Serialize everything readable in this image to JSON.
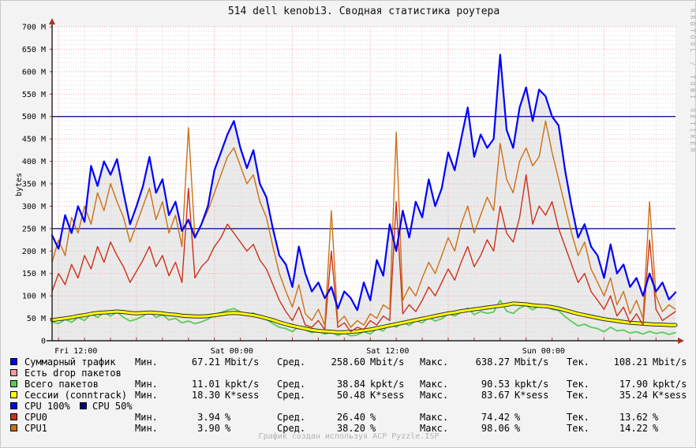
{
  "title": "514 dell kenobi3. Сводная статистика роутера",
  "watermark": "RRDTOOL / TOBI OETIKER",
  "footer": "График создан используя ACP Pyzzle.ISP",
  "legend": {
    "min_label": "Мин.",
    "avg_label": "Сред.",
    "max_label": "Макс.",
    "cur_label": "Тек.",
    "rows": [
      {
        "label": "Суммарный трафик",
        "color": "#0000ff",
        "min": "67.21",
        "avg": "258.60",
        "max": "638.27",
        "cur": "108.21",
        "unit": "Mbit/s"
      },
      {
        "label": "Есть drop пакетов",
        "color": "#ff9999"
      },
      {
        "label": "Всего пакетов",
        "color": "#59cc59",
        "min": "11.01",
        "avg": "38.84",
        "max": "90.53",
        "cur": "17.90",
        "unit": "kpkt/s"
      },
      {
        "label": "Сессии (conntrack)",
        "color": "#ffff00",
        "min": "18.30",
        "avg": "50.48",
        "max": "83.67",
        "cur": "35.24",
        "unit": "K*sess"
      },
      {
        "label": "CPU 100%",
        "color": "#0000ff",
        "label2": "CPU 50%",
        "color2": "#000080"
      },
      {
        "label": "CPU0",
        "color": "#cc3118",
        "min": "3.94",
        "avg": "26.40",
        "max": "74.42",
        "cur": "13.62",
        "unit": "%"
      },
      {
        "label": "CPU1",
        "color": "#cc7016",
        "min": "3.90",
        "avg": "38.20",
        "max": "98.06",
        "cur": "14.22",
        "unit": "%"
      }
    ]
  },
  "chart_data": {
    "type": "line",
    "title": "514 dell kenobi3. Сводная статистика роутера",
    "ylabel": "bytes",
    "ylim": [
      0,
      700
    ],
    "x_span_hours": 48,
    "x_start": "Fri 11:30",
    "grid": {
      "h_minor_step": 10,
      "h_major_step": 50,
      "v_minor_step_hours": 2,
      "v_major_step_hours": 6
    },
    "y_ticks": [
      "0",
      "50 M",
      "100 M",
      "150 M",
      "200 M",
      "250 M",
      "300 M",
      "350 M",
      "400 M",
      "450 M",
      "500 M",
      "550 M",
      "600 M",
      "650 M",
      "700 M"
    ],
    "x_ticks": [
      {
        "label": "Fri 12:00",
        "t": 0.5
      },
      {
        "label": "Sat 00:00",
        "t": 12.5
      },
      {
        "label": "Sat 12:00",
        "t": 24.5
      },
      {
        "label": "Sun 00:00",
        "t": 36.5
      }
    ],
    "ref_lines": [
      {
        "name": "CPU 100%",
        "value": 500,
        "color": "#000080"
      },
      {
        "name": "CPU 50%",
        "value": 250,
        "color": "#000080"
      }
    ],
    "colors": {
      "canvas": "#ffffff",
      "background": "#f3f3f3",
      "area_fill": "#eaeaea",
      "grid_minor": "#d9d9d9",
      "grid_major": "#f0a8a8",
      "axis": "#1f1f1f",
      "arrow": "#aa3327"
    },
    "series": [
      {
        "name": "Суммарный трафик",
        "unit": "Mbit/s",
        "color": "#0000ff",
        "area_fill": "#eaeaea",
        "min": 67.21,
        "avg": 258.6,
        "max": 638.27,
        "cur": 108.21,
        "values": [
          235,
          205,
          280,
          240,
          300,
          265,
          390,
          345,
          400,
          370,
          405,
          330,
          260,
          300,
          345,
          410,
          330,
          360,
          280,
          310,
          245,
          270,
          230,
          260,
          300,
          380,
          420,
          460,
          490,
          430,
          385,
          425,
          350,
          320,
          250,
          190,
          170,
          120,
          210,
          150,
          110,
          130,
          95,
          120,
          72,
          110,
          95,
          68,
          130,
          90,
          180,
          145,
          260,
          200,
          290,
          230,
          310,
          275,
          360,
          300,
          340,
          420,
          380,
          450,
          520,
          410,
          460,
          430,
          450,
          638,
          470,
          430,
          520,
          565,
          490,
          560,
          545,
          500,
          480,
          380,
          300,
          230,
          260,
          210,
          190,
          140,
          215,
          150,
          170,
          120,
          140,
          100,
          150,
          110,
          130,
          92,
          108
        ]
      },
      {
        "name": "Есть drop пакетов",
        "unit": "",
        "color": "#ff9999",
        "values": []
      },
      {
        "name": "Всего пакетов",
        "unit": "kpkt/s",
        "color": "#59cc59",
        "min": 11.01,
        "avg": 38.84,
        "max": 90.53,
        "cur": 17.9,
        "values": [
          42,
          38,
          48,
          41,
          52,
          45,
          60,
          52,
          63,
          55,
          64,
          52,
          44,
          48,
          55,
          65,
          52,
          58,
          46,
          50,
          40,
          44,
          38,
          42,
          48,
          58,
          63,
          68,
          72,
          64,
          58,
          62,
          52,
          48,
          38,
          30,
          27,
          20,
          32,
          24,
          18,
          21,
          15,
          19,
          12,
          17,
          11,
          13,
          20,
          15,
          27,
          22,
          38,
          30,
          42,
          34,
          45,
          40,
          52,
          44,
          49,
          60,
          55,
          64,
          73,
          58,
          65,
          61,
          64,
          90,
          66,
          61,
          73,
          79,
          69,
          78,
          76,
          70,
          67,
          54,
          43,
          33,
          37,
          30,
          27,
          20,
          30,
          22,
          24,
          17,
          20,
          15,
          21,
          16,
          19,
          14,
          18
        ]
      },
      {
        "name": "Сессии (conntrack)",
        "unit": "K*sess",
        "color": "#ffff00",
        "outline": "#2e2e2e",
        "min": 18.3,
        "avg": 50.48,
        "max": 83.67,
        "cur": 35.24,
        "values": [
          46,
          48,
          50,
          52,
          55,
          57,
          60,
          62,
          63,
          64,
          65,
          64,
          62,
          61,
          62,
          63,
          62,
          61,
          59,
          58,
          56,
          55,
          54,
          54,
          55,
          57,
          59,
          61,
          62,
          61,
          59,
          57,
          54,
          50,
          46,
          41,
          37,
          33,
          30,
          27,
          24,
          22,
          21,
          20,
          19,
          19,
          20,
          21,
          23,
          25,
          28,
          31,
          34,
          37,
          40,
          43,
          46,
          49,
          52,
          55,
          58,
          61,
          63,
          66,
          68,
          70,
          72,
          74,
          76,
          78,
          80,
          83,
          82,
          81,
          79,
          78,
          77,
          75,
          72,
          68,
          64,
          60,
          57,
          54,
          51,
          48,
          46,
          44,
          42,
          40,
          39,
          38,
          37,
          36,
          36,
          35,
          35
        ]
      },
      {
        "name": "CPU0",
        "unit": "%",
        "color": "#cc3118",
        "scale_to_plot": 5,
        "min": 3.94,
        "avg": 26.4,
        "max": 74.42,
        "cur": 13.62,
        "values": [
          22,
          30,
          25,
          34,
          28,
          38,
          32,
          42,
          35,
          44,
          38,
          33,
          26,
          31,
          36,
          42,
          33,
          38,
          29,
          35,
          26,
          68,
          28,
          33,
          36,
          42,
          46,
          52,
          48,
          44,
          40,
          43,
          36,
          32,
          25,
          18,
          13,
          9,
          15,
          7,
          6,
          9,
          5,
          40,
          6,
          8,
          4,
          6,
          5,
          9,
          7,
          11,
          9,
          62,
          12,
          16,
          13,
          18,
          24,
          20,
          26,
          32,
          27,
          35,
          42,
          33,
          38,
          45,
          40,
          60,
          48,
          44,
          55,
          74,
          52,
          60,
          56,
          62,
          50,
          42,
          34,
          26,
          30,
          22,
          18,
          14,
          20,
          11,
          15,
          8,
          12,
          7,
          45,
          14,
          9,
          11,
          13
        ]
      },
      {
        "name": "CPU1",
        "unit": "%",
        "color": "#cc7016",
        "scale_to_plot": 5,
        "min": 3.9,
        "avg": 38.2,
        "max": 98.06,
        "cur": 14.22,
        "values": [
          35,
          45,
          38,
          55,
          48,
          60,
          52,
          66,
          58,
          70,
          62,
          55,
          44,
          52,
          60,
          68,
          54,
          62,
          48,
          56,
          42,
          95,
          46,
          52,
          58,
          66,
          74,
          82,
          86,
          78,
          70,
          74,
          62,
          55,
          42,
          30,
          22,
          15,
          25,
          12,
          9,
          14,
          7,
          58,
          8,
          11,
          6,
          9,
          7,
          12,
          10,
          16,
          14,
          93,
          18,
          24,
          20,
          28,
          35,
          30,
          38,
          46,
          40,
          52,
          60,
          48,
          56,
          64,
          58,
          88,
          72,
          66,
          80,
          86,
          78,
          82,
          98,
          84,
          72,
          60,
          48,
          38,
          44,
          32,
          26,
          20,
          28,
          16,
          22,
          12,
          18,
          10,
          62,
          20,
          13,
          16,
          14
        ]
      }
    ]
  }
}
